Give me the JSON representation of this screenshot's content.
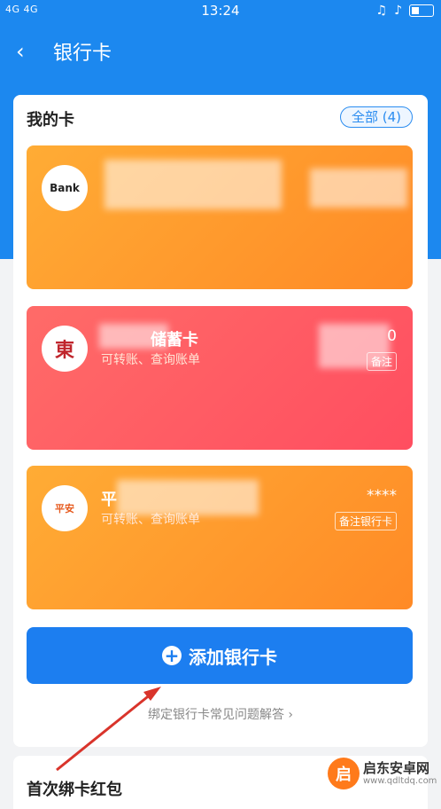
{
  "status": {
    "signal_left": "4G 4G",
    "time": "13:24",
    "icons": [
      "headset-icon",
      "mute-icon",
      "battery-icon"
    ]
  },
  "nav": {
    "back_icon": "‹",
    "title": "银行卡"
  },
  "cards_panel": {
    "title": "我的卡",
    "all_label": "全部 (4)",
    "cards": [
      {
        "logo": "Bank",
        "name": "",
        "sub": "",
        "number": "",
        "note": ""
      },
      {
        "logo": "東",
        "name": "储蓄卡",
        "sub": "可转账、查询账单",
        "number": "0",
        "note": "备注"
      },
      {
        "logo": "平安",
        "name": "平",
        "sub": "可转账、查询账单",
        "number": "****",
        "note": "备注银行卡"
      }
    ]
  },
  "add_card": {
    "icon": "+",
    "label": "添加银行卡"
  },
  "faq": {
    "label": "绑定银行卡常见问题解答 ›"
  },
  "bottom": {
    "title": "首次绑卡红包"
  },
  "watermark": {
    "icon": "启",
    "title": "启东安卓网",
    "url": "www.qdltdq.com"
  }
}
